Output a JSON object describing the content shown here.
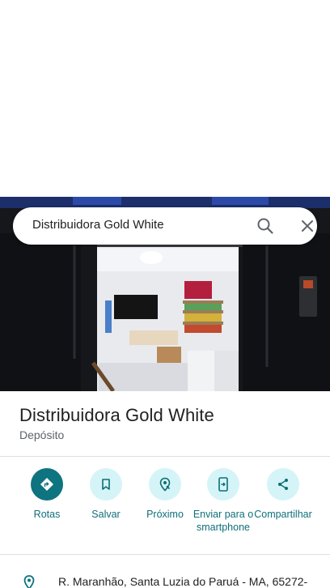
{
  "search": {
    "query": "Distribuidora Gold White"
  },
  "place": {
    "name": "Distribuidora Gold White",
    "category": "Depósito"
  },
  "actions": [
    {
      "label": "Rotas",
      "icon": "directions-icon"
    },
    {
      "label": "Salvar",
      "icon": "bookmark-icon"
    },
    {
      "label": "Próximo",
      "icon": "nearby-icon"
    },
    {
      "label": "Enviar para o smartphone",
      "icon": "send-to-phone-icon"
    },
    {
      "label": "Compartilhar",
      "icon": "share-icon"
    }
  ],
  "address": {
    "text": "R. Maranhão, Santa Luzia do Paruá - MA, 65272-"
  },
  "colors": {
    "accent": "#0d7480",
    "accent_light": "#d5f4f7",
    "label": "#0f6f7a"
  }
}
